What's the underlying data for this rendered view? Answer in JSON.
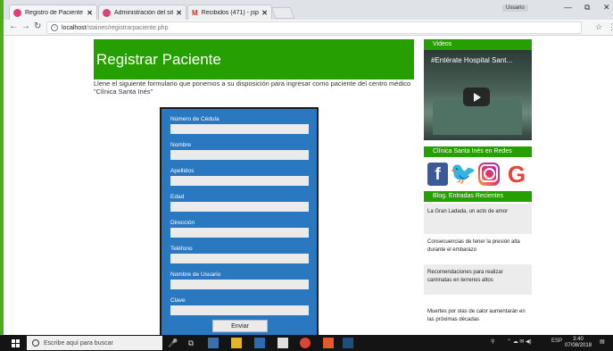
{
  "browser": {
    "tabs": [
      {
        "label": "Registro de Paciente | Cl",
        "close": "✕",
        "icon": "site-favicon"
      },
      {
        "label": "Administración del sitio",
        "close": "✕",
        "icon": "site-favicon"
      },
      {
        "label": "Recibidos (471) - jspico",
        "close": "✕",
        "icon": "gmail-favicon"
      }
    ],
    "profile": "Usuario",
    "url_host": "localhost",
    "url_path": "/staines/registrarpaciente.php"
  },
  "page": {
    "title": "Registrar Paciente",
    "intro": "Llene el siguiente formulario que ponemos a su disposición para ingresar como paciente del centro médico \"Clínica Santa Inés\"",
    "form_fields": [
      {
        "label": "Número de Cédula",
        "value": ""
      },
      {
        "label": "Nombre",
        "value": ""
      },
      {
        "label": "Apellidos",
        "value": ""
      },
      {
        "label": "Edad",
        "value": ""
      },
      {
        "label": "Dirección",
        "value": ""
      },
      {
        "label": "Teléfono",
        "value": ""
      },
      {
        "label": "Nombre de Usuario",
        "value": ""
      },
      {
        "label": "Clave",
        "value": ""
      }
    ],
    "submit_label": "Enviar"
  },
  "sidebar": {
    "videos_heading": "Videos",
    "video_title": "#Entérate Hospital Sant...",
    "social_heading": "Clínica Santa Inés en Redes",
    "social": [
      {
        "name": "facebook",
        "glyph": "f"
      },
      {
        "name": "twitter",
        "glyph": "🐦"
      },
      {
        "name": "instagram",
        "glyph": ""
      },
      {
        "name": "google",
        "glyph": "G"
      }
    ],
    "blog_heading": "Blog. Entradas Recientes",
    "posts": [
      "La Gran Ladada, un acto de amor",
      "Consecuencias de tener la presión alta durante el embarazo",
      "Recomendaciones para realizar caminatas en terrenos altos",
      "Muertes por olas de calor aumentarán en las próximas décadas"
    ]
  },
  "taskbar": {
    "search_placeholder": "Escribe aquí para buscar",
    "language": "ESP",
    "time": "3:40",
    "date": "07/08/2018"
  }
}
